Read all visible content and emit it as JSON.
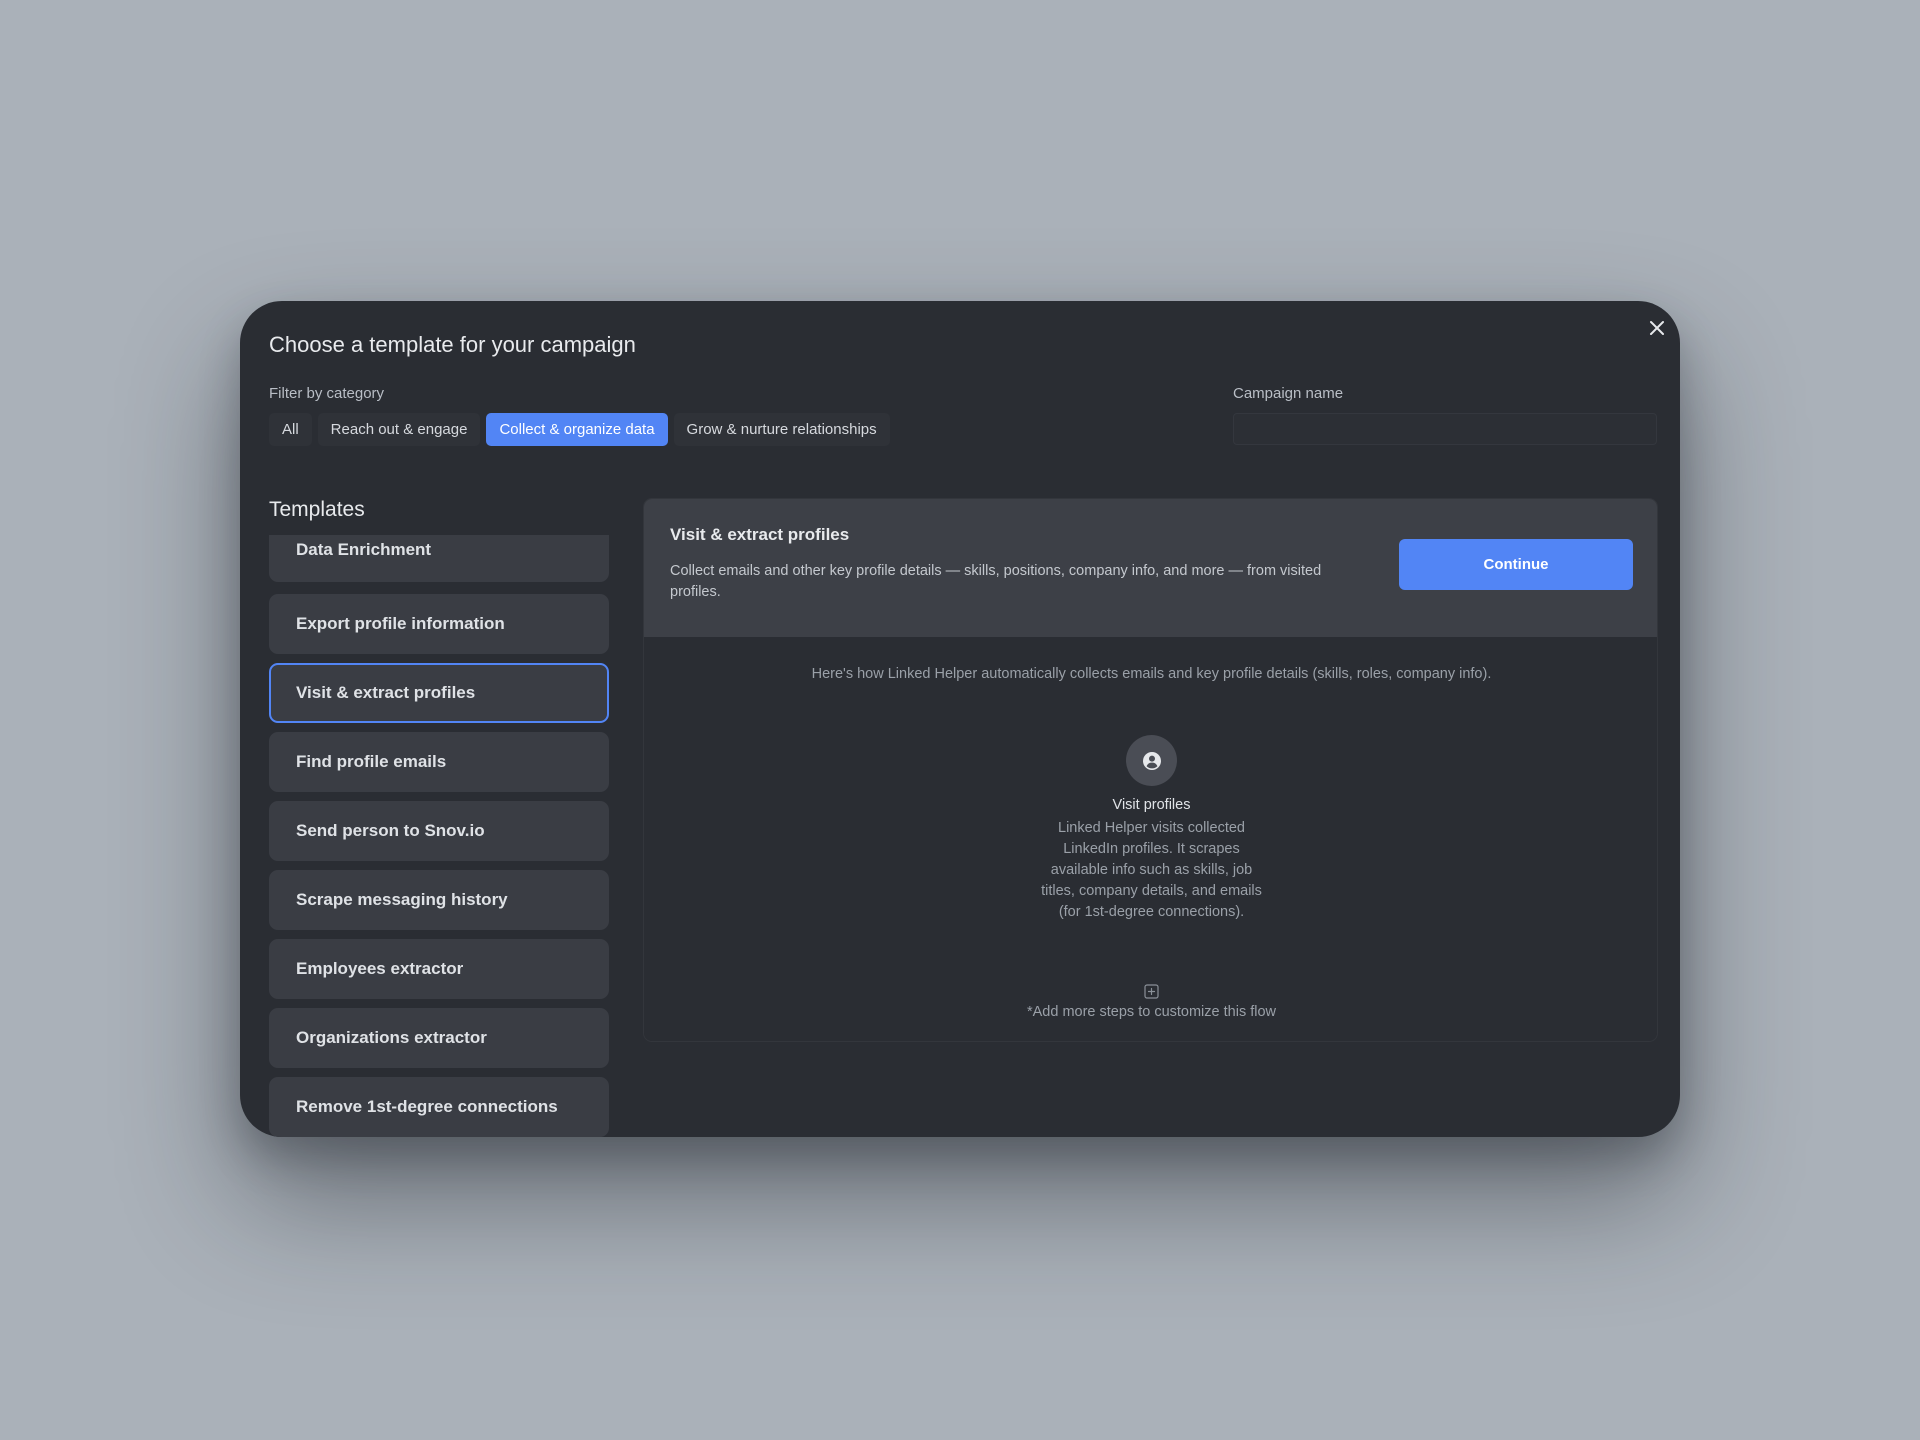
{
  "modal": {
    "title": "Choose a template for your campaign",
    "close_icon": "close-icon"
  },
  "filter": {
    "label": "Filter by category",
    "chips": [
      {
        "label": "All",
        "active": false
      },
      {
        "label": "Reach out & engage",
        "active": false
      },
      {
        "label": "Collect & organize data",
        "active": true
      },
      {
        "label": "Grow & nurture relationships",
        "active": false
      }
    ]
  },
  "campaign": {
    "label": "Campaign name",
    "value": "",
    "placeholder": ""
  },
  "templates": {
    "heading": "Templates",
    "items": [
      {
        "label": "Data Enrichment",
        "selected": false
      },
      {
        "label": "Export profile information",
        "selected": false
      },
      {
        "label": "Visit & extract profiles",
        "selected": true
      },
      {
        "label": "Find profile emails",
        "selected": false
      },
      {
        "label": "Send person to Snov.io",
        "selected": false
      },
      {
        "label": "Scrape messaging history",
        "selected": false
      },
      {
        "label": "Employees extractor",
        "selected": false
      },
      {
        "label": "Organizations extractor",
        "selected": false
      },
      {
        "label": "Remove 1st-degree connections",
        "selected": false
      }
    ]
  },
  "detail": {
    "title": "Visit & extract profiles",
    "description": "Collect emails and other key profile details — skills, positions, company info, and more — from visited profiles.",
    "continue_label": "Continue",
    "how_it_works": "Here's how Linked Helper automatically collects emails and key profile details (skills, roles, company info).",
    "step": {
      "icon": "user-circle-icon",
      "title": "Visit profiles",
      "description": "Linked Helper visits collected LinkedIn profiles. It scrapes available info such as skills, job titles, company details, and emails (for 1st-degree connections)."
    },
    "add_steps_icon": "plus-square-icon",
    "add_steps_text": "*Add more steps to customize this flow"
  },
  "colors": {
    "accent": "#5285f5",
    "modal_bg": "#2a2d33",
    "backdrop": "#aab1b9",
    "item_bg": "#3a3d44"
  }
}
